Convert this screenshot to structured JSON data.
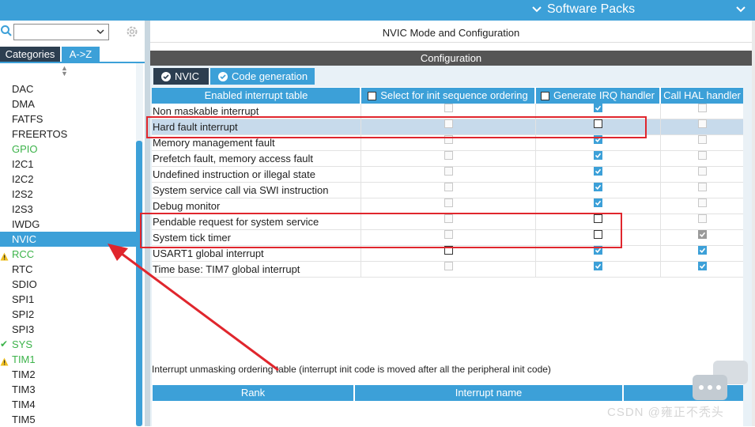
{
  "top_bar": {
    "title": "Software Packs"
  },
  "left": {
    "search": {
      "value": ""
    },
    "tabs": {
      "categories": "Categories",
      "az": "A->Z"
    },
    "items": [
      {
        "label": "DAC",
        "status": "none"
      },
      {
        "label": "DMA",
        "status": "none"
      },
      {
        "label": "FATFS",
        "status": "none"
      },
      {
        "label": "FREERTOS",
        "status": "none"
      },
      {
        "label": "GPIO",
        "status": "green"
      },
      {
        "label": "I2C1",
        "status": "none"
      },
      {
        "label": "I2C2",
        "status": "none"
      },
      {
        "label": "I2S2",
        "status": "none"
      },
      {
        "label": "I2S3",
        "status": "none"
      },
      {
        "label": "IWDG",
        "status": "none"
      },
      {
        "label": "NVIC",
        "status": "selected"
      },
      {
        "label": "RCC",
        "status": "warning"
      },
      {
        "label": "RTC",
        "status": "none"
      },
      {
        "label": "SDIO",
        "status": "none"
      },
      {
        "label": "SPI1",
        "status": "none"
      },
      {
        "label": "SPI2",
        "status": "none"
      },
      {
        "label": "SPI3",
        "status": "none"
      },
      {
        "label": "SYS",
        "status": "check"
      },
      {
        "label": "TIM1",
        "status": "warning"
      },
      {
        "label": "TIM2",
        "status": "none"
      },
      {
        "label": "TIM3",
        "status": "none"
      },
      {
        "label": "TIM4",
        "status": "none"
      },
      {
        "label": "TIM5",
        "status": "none"
      }
    ]
  },
  "right": {
    "mode_title": "NVIC Mode and Configuration",
    "config_title": "Configuration",
    "tabs": {
      "nvic": "NVIC",
      "codegen": "Code generation"
    },
    "table": {
      "headers": [
        "Enabled interrupt table",
        "Select for init sequence ordering",
        "Generate IRQ handler",
        "Call HAL handler"
      ],
      "rows": [
        {
          "name": "Non maskable interrupt",
          "init": "disabled",
          "irq": "checked",
          "hal": "disabled",
          "selected": false
        },
        {
          "name": "Hard fault interrupt",
          "init": "disabled",
          "irq": "unchecked",
          "hal": "disabled",
          "selected": true
        },
        {
          "name": "Memory management fault",
          "init": "disabled",
          "irq": "checked",
          "hal": "disabled",
          "selected": false
        },
        {
          "name": "Prefetch fault, memory access fault",
          "init": "disabled",
          "irq": "checked",
          "hal": "disabled",
          "selected": false
        },
        {
          "name": "Undefined instruction or illegal state",
          "init": "disabled",
          "irq": "checked",
          "hal": "disabled",
          "selected": false
        },
        {
          "name": "System service call via SWI instruction",
          "init": "disabled",
          "irq": "checked",
          "hal": "disabled",
          "selected": false
        },
        {
          "name": "Debug monitor",
          "init": "disabled",
          "irq": "checked",
          "hal": "disabled",
          "selected": false
        },
        {
          "name": "Pendable request for system service",
          "init": "disabled",
          "irq": "unchecked",
          "hal": "disabled",
          "selected": false
        },
        {
          "name": "System tick timer",
          "init": "disabled",
          "irq": "unchecked",
          "hal": "checked-grey",
          "selected": false
        },
        {
          "name": "USART1 global interrupt",
          "init": "unchecked",
          "irq": "checked",
          "hal": "checked",
          "selected": false
        },
        {
          "name": "Time base: TIM7 global interrupt",
          "init": "disabled",
          "irq": "checked",
          "hal": "checked",
          "selected": false
        }
      ]
    },
    "unmask_label": "Interrupt unmasking ordering table (interrupt init code is moved after all the peripheral init code)",
    "order_table": {
      "headers": [
        "Rank",
        "Interrupt name"
      ]
    }
  },
  "watermark": "CSDN @雍正不秃头",
  "colors": {
    "accent": "#3ca0d8",
    "dark_tab": "#2c3e50",
    "annotation": "#e0262d",
    "green": "#3cb34a"
  }
}
